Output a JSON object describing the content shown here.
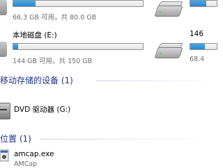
{
  "hard_drives": [
    {
      "name": "",
      "info": "66.3 GB 可用，共 80.0 GB",
      "fraction_used": 0.17
    },
    {
      "name": "本地磁盘 (E:)",
      "info": "144 GB 可用，共 150 GB",
      "fraction_used": 0.04
    }
  ],
  "right_column": {
    "drive1_label_partial": "146",
    "drive2_info_partial": "68.4"
  },
  "removable_section": {
    "title": "移动存储的设备 (1)",
    "items": [
      {
        "name": "DVD 驱动器 (G:)"
      }
    ]
  },
  "location_section": {
    "title": "位置 (1)",
    "items": [
      {
        "name": "amcap.exe",
        "subtitle": "AMCap"
      }
    ]
  },
  "colors": {
    "section_title": "#1e3287",
    "bar_fill": "#2a86d1"
  }
}
